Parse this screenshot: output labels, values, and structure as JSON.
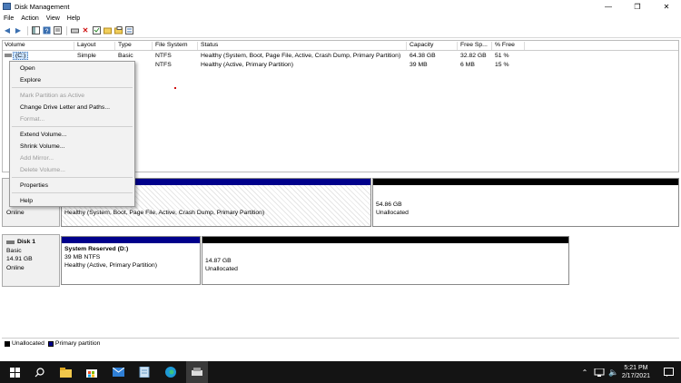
{
  "window": {
    "title": "Disk Management",
    "minimize": "—",
    "maximize": "❐",
    "close": "✕"
  },
  "menu": [
    "File",
    "Action",
    "View",
    "Help"
  ],
  "columns": [
    "Volume",
    "Layout",
    "Type",
    "File System",
    "Status",
    "Capacity",
    "Free Sp...",
    "% Free"
  ],
  "volumes": [
    {
      "volume": "(C:)",
      "layout": "Simple",
      "type": "Basic",
      "fs": "NTFS",
      "status": "Healthy (System, Boot, Page File, Active, Crash Dump, Primary Partition)",
      "capacity": "64.38 GB",
      "free": "32.82 GB",
      "pct": "51 %"
    },
    {
      "volume": "",
      "layout": "",
      "type": "",
      "fs": "NTFS",
      "status": "Healthy (Active, Primary Partition)",
      "capacity": "39 MB",
      "free": "6 MB",
      "pct": "15 %"
    }
  ],
  "context_menu": {
    "open": "Open",
    "explore": "Explore",
    "mark_active": "Mark Partition as Active",
    "change_letter": "Change Drive Letter and Paths...",
    "format": "Format...",
    "extend": "Extend Volume...",
    "shrink": "Shrink Volume...",
    "add_mirror": "Add Mirror...",
    "delete": "Delete Volume...",
    "properties": "Properties",
    "help": "Help"
  },
  "disk0": {
    "status": "Online",
    "c_status": "Healthy (System, Boot, Page File, Active, Crash Dump, Primary Partition)",
    "unalloc_size": "54.86 GB",
    "unalloc_label": "Unallocated"
  },
  "disk1": {
    "name": "Disk 1",
    "type": "Basic",
    "size": "14.91 GB",
    "status": "Online",
    "part_name": "System Reserved  (D:)",
    "part_size": "39 MB NTFS",
    "part_status": "Healthy (Active, Primary Partition)",
    "unalloc_size": "14.87 GB",
    "unalloc_label": "Unallocated"
  },
  "legend": {
    "unallocated": "Unallocated",
    "primary": "Primary partition"
  },
  "colors": {
    "primary": "#00008b",
    "unallocated": "#000000",
    "taskbar": "#141414"
  },
  "taskbar": {
    "time": "5:21 PM",
    "date": "2/17/2021"
  }
}
